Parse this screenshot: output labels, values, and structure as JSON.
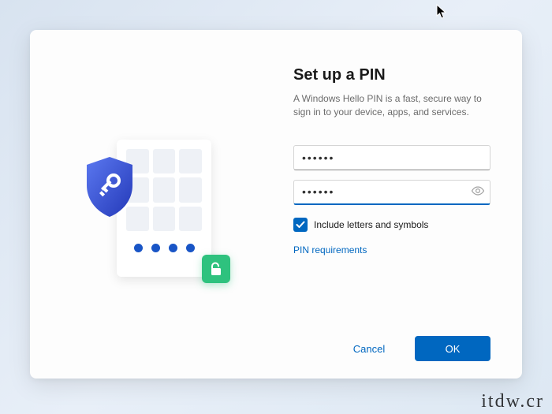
{
  "dialog": {
    "title": "Set up a PIN",
    "description": "A Windows Hello PIN is a fast, secure way to sign in to your device, apps, and services.",
    "pin_value": "••••••",
    "confirm_value": "••••••",
    "checkbox": {
      "checked": true,
      "label": "Include letters and symbols"
    },
    "link": "PIN requirements",
    "buttons": {
      "cancel": "Cancel",
      "ok": "OK"
    }
  },
  "watermark": "itdw.cr",
  "colors": {
    "accent": "#0067c0",
    "shield": "#2f4bd8",
    "lock_badge": "#2ec27e"
  }
}
